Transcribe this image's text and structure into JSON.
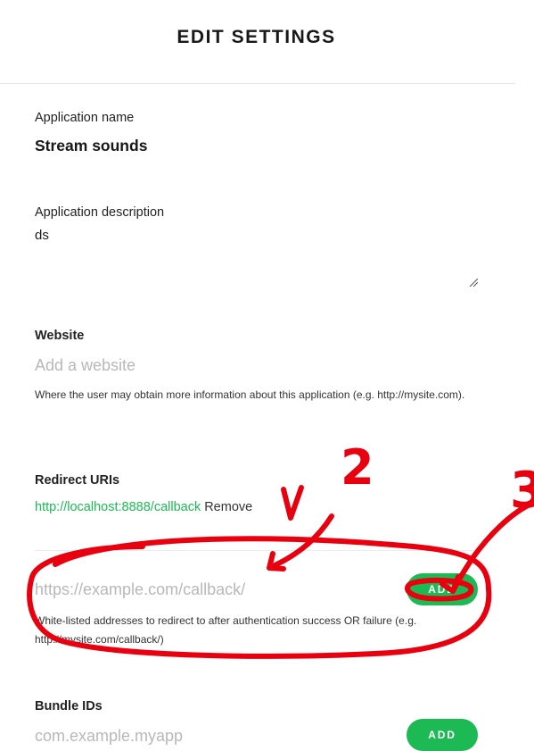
{
  "header": {
    "title": "EDIT SETTINGS"
  },
  "app_name": {
    "label": "Application name",
    "value": "Stream sounds"
  },
  "app_description": {
    "label": "Application description",
    "value": "ds"
  },
  "website": {
    "label": "Website",
    "placeholder": "Add a website",
    "help": "Where the user may obtain more information about this application (e.g. http://mysite.com)."
  },
  "redirect_uris": {
    "label": "Redirect URIs",
    "items": [
      {
        "url": "http://localhost:8888/callback",
        "remove_label": "Remove"
      }
    ],
    "placeholder": "https://example.com/callback/",
    "add_label": "ADD",
    "help": "White-listed addresses to redirect to after authentication success OR failure (e.g. http://mysite.com/callback/)"
  },
  "bundle_ids": {
    "label": "Bundle IDs",
    "placeholder": "com.example.myapp",
    "add_label": "ADD"
  },
  "annotations": {
    "color": "#e8000f",
    "labels": [
      "2",
      "3"
    ]
  },
  "colors": {
    "accent": "#1db954",
    "annotation": "#e8000f"
  }
}
